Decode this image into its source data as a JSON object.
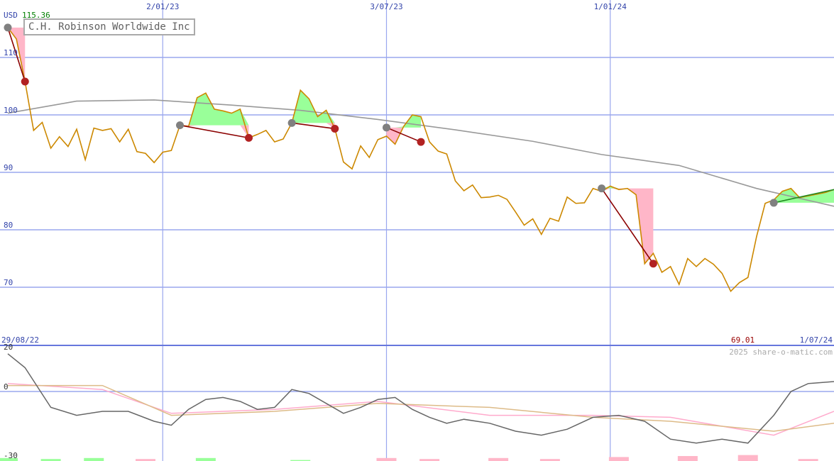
{
  "title": "C.H. Robinson Worldwide Inc",
  "currency": "USD",
  "top_value": "115.36",
  "low_value": "69.01",
  "start_date": "29/08/22",
  "end_date": "1/07/24",
  "watermark": "2025 share-o-matic.com",
  "colors": {
    "price": "#cc8800",
    "average": "#999999",
    "gain_fill": "#99ff99",
    "loss_fill": "#ffb6c8",
    "trade_loss_line": "#8b0000",
    "trade_gain_line": "#228b22",
    "entry_marker": "#808080",
    "exit_marker": "#b22222",
    "grid": "#9aa7ee",
    "axis_text": "#3344aa",
    "osc_price": "#666666",
    "osc_pink": "#ffaacc",
    "osc_tan": "#ddbb88"
  },
  "chart_data": [
    {
      "type": "line",
      "title": "C.H. Robinson Worldwide Inc",
      "ylabel": "USD",
      "ylim": [
        64.5,
        120
      ],
      "y_ticks": [
        70,
        80,
        90,
        100,
        110
      ],
      "x_range": [
        "29/08/22",
        "1/07/24"
      ],
      "x_ticks": [
        "2/01/23",
        "3/07/23",
        "1/01/24"
      ],
      "annotations": [
        "115.36",
        "69.01"
      ],
      "grid": true,
      "series": [
        {
          "role": "price",
          "x": [
            "2022-08-29",
            "2022-09-05",
            "2022-09-12",
            "2022-09-19",
            "2022-09-26",
            "2022-10-03",
            "2022-10-10",
            "2022-10-17",
            "2022-10-24",
            "2022-10-31",
            "2022-11-07",
            "2022-11-14",
            "2022-11-21",
            "2022-11-28",
            "2022-12-05",
            "2022-12-12",
            "2022-12-19",
            "2022-12-26",
            "2023-01-02",
            "2023-01-09",
            "2023-01-16",
            "2023-01-23",
            "2023-01-30",
            "2023-02-06",
            "2023-02-13",
            "2023-02-20",
            "2023-02-27",
            "2023-03-06",
            "2023-03-13",
            "2023-03-20",
            "2023-03-27",
            "2023-04-03",
            "2023-04-10",
            "2023-04-17",
            "2023-04-24",
            "2023-05-01",
            "2023-05-08",
            "2023-05-15",
            "2023-05-22",
            "2023-05-29",
            "2023-06-05",
            "2023-06-12",
            "2023-06-19",
            "2023-06-26",
            "2023-07-03",
            "2023-07-10",
            "2023-07-17",
            "2023-07-24",
            "2023-07-31",
            "2023-08-07",
            "2023-08-14",
            "2023-08-21",
            "2023-08-28",
            "2023-09-04",
            "2023-09-11",
            "2023-09-18",
            "2023-09-25",
            "2023-10-02",
            "2023-10-09",
            "2023-10-16",
            "2023-10-23",
            "2023-10-30",
            "2023-11-06",
            "2023-11-13",
            "2023-11-20",
            "2023-11-27",
            "2023-12-04",
            "2023-12-11",
            "2023-12-18",
            "2023-12-25",
            "2024-01-01",
            "2024-01-08",
            "2024-01-15",
            "2024-01-22",
            "2024-01-29",
            "2024-02-05",
            "2024-02-12",
            "2024-02-19",
            "2024-02-26",
            "2024-03-04",
            "2024-03-11",
            "2024-03-18",
            "2024-03-25",
            "2024-04-01",
            "2024-04-08",
            "2024-04-15",
            "2024-04-22",
            "2024-04-29",
            "2024-05-06",
            "2024-05-13",
            "2024-05-20",
            "2024-05-27",
            "2024-06-03",
            "2024-06-10",
            "2024-06-17",
            "2024-06-24",
            "2024-07-01"
          ],
          "values": [
            115.2,
            113.2,
            105.8,
            97.3,
            98.7,
            94.2,
            96.2,
            94.5,
            97.5,
            92.2,
            97.7,
            97.3,
            97.6,
            95.3,
            97.5,
            93.6,
            93.3,
            91.7,
            93.5,
            93.8,
            98.2,
            98.0,
            103.0,
            103.8,
            101.0,
            100.7,
            100.3,
            101.0,
            96.0,
            96.6,
            97.3,
            95.3,
            95.8,
            98.6,
            104.3,
            102.8,
            99.7,
            100.8,
            97.6,
            91.8,
            90.6,
            94.6,
            92.6,
            95.7,
            96.3,
            94.9,
            98.0,
            100.0,
            99.7,
            95.3,
            93.7,
            93.2,
            88.5,
            86.8,
            87.8,
            85.6,
            85.7,
            86.0,
            85.3,
            83.1,
            80.8,
            81.9,
            79.2,
            82.0,
            81.5,
            85.7,
            84.6,
            84.7,
            87.2,
            86.7,
            87.6,
            87.0,
            87.2,
            86.1,
            74.1,
            75.9,
            72.6,
            73.6,
            70.5,
            75.0,
            73.6,
            75.0,
            74.0,
            72.4,
            69.3,
            70.8,
            71.7,
            78.8,
            84.6,
            85.2,
            86.7,
            87.2,
            85.6,
            85.9,
            86.2,
            86.5,
            87.0
          ]
        },
        {
          "role": "moving-average",
          "x": [
            "2022-08-29",
            "2022-10-24",
            "2022-12-26",
            "2023-02-27",
            "2023-04-24",
            "2023-06-26",
            "2023-08-28",
            "2023-10-30",
            "2023-12-25",
            "2024-02-26",
            "2024-04-29",
            "2024-07-01"
          ],
          "values": [
            100.3,
            102.4,
            102.6,
            101.7,
            100.8,
            99.2,
            97.4,
            95.4,
            93.1,
            91.2,
            87.2,
            84.1
          ]
        }
      ],
      "trades": [
        {
          "entry_date": "2022-08-29",
          "entry": 115.2,
          "exit_date": "2022-09-12",
          "exit": 105.8,
          "result": "loss"
        },
        {
          "entry_date": "2023-01-16",
          "entry": 98.2,
          "exit_date": "2023-03-13",
          "exit": 96.0,
          "result": "loss"
        },
        {
          "entry_date": "2023-04-17",
          "entry": 98.6,
          "exit_date": "2023-05-22",
          "exit": 97.6,
          "result": "loss"
        },
        {
          "entry_date": "2023-07-03",
          "entry": 97.8,
          "exit_date": "2023-07-31",
          "exit": 95.3,
          "result": "loss"
        },
        {
          "entry_date": "2023-12-25",
          "entry": 87.2,
          "exit_date": "2024-02-05",
          "exit": 74.1,
          "result": "loss"
        },
        {
          "entry_date": "2024-05-13",
          "entry": 84.7,
          "exit_date": "2024-07-01",
          "exit": 87.0,
          "result": "gain"
        }
      ]
    },
    {
      "type": "line",
      "ylim": [
        -30,
        20
      ],
      "y_ticks": [
        20,
        0,
        -30
      ],
      "grid": true,
      "series": [
        {
          "role": "oscillator",
          "x": [
            "2022-08-29",
            "2022-09-12",
            "2022-10-03",
            "2022-10-24",
            "2022-11-14",
            "2022-12-05",
            "2022-12-26",
            "2023-01-09",
            "2023-01-23",
            "2023-02-06",
            "2023-02-20",
            "2023-03-06",
            "2023-03-20",
            "2023-04-03",
            "2023-04-17",
            "2023-05-01",
            "2023-05-15",
            "2023-05-29",
            "2023-06-12",
            "2023-06-26",
            "2023-07-10",
            "2023-07-24",
            "2023-08-07",
            "2023-08-21",
            "2023-09-04",
            "2023-09-25",
            "2023-10-16",
            "2023-11-06",
            "2023-11-27",
            "2023-12-18",
            "2024-01-08",
            "2024-01-29",
            "2024-02-19",
            "2024-03-11",
            "2024-04-01",
            "2024-04-22",
            "2024-05-13",
            "2024-05-27",
            "2024-06-10",
            "2024-07-01"
          ],
          "values": [
            19,
            12,
            -8,
            -12,
            -10,
            -10,
            -15,
            -17,
            -9,
            -4,
            -3,
            -5,
            -9,
            -8,
            1,
            -1,
            -6,
            -11,
            -8,
            -4,
            -3,
            -9,
            -13,
            -16,
            -14,
            -16,
            -20,
            -22,
            -19,
            -13,
            -12,
            -15,
            -24,
            -26,
            -24,
            -26,
            -12,
            0,
            4,
            5
          ]
        },
        {
          "role": "signal-pink",
          "x": [
            "2022-08-29",
            "2022-11-14",
            "2023-01-09",
            "2023-04-03",
            "2023-06-26",
            "2023-09-25",
            "2023-12-18",
            "2024-02-19",
            "2024-05-13",
            "2024-07-01"
          ],
          "values": [
            4,
            1,
            -11,
            -9,
            -5,
            -12,
            -12,
            -13,
            -22,
            -10
          ]
        },
        {
          "role": "signal-tan",
          "x": [
            "2022-08-29",
            "2022-11-14",
            "2023-01-09",
            "2023-04-03",
            "2023-06-26",
            "2023-09-25",
            "2023-12-18",
            "2024-02-19",
            "2024-05-13",
            "2024-07-01"
          ],
          "values": [
            3,
            3,
            -12,
            -10,
            -6,
            -8,
            -13,
            -15,
            -20,
            -16
          ]
        },
        {
          "role": "volume-bars",
          "x": [
            "2022-08-29",
            "2022-10-03",
            "2022-11-07",
            "2022-12-19",
            "2023-02-06",
            "2023-04-24",
            "2023-07-03",
            "2023-08-07",
            "2023-10-02",
            "2023-11-13",
            "2024-01-08",
            "2024-03-04",
            "2024-04-22",
            "2024-06-10"
          ],
          "values": [
            3,
            2,
            3,
            2,
            3,
            1,
            3,
            2,
            3,
            2,
            4,
            5,
            6,
            2
          ],
          "colors": [
            "gain",
            "gain",
            "gain",
            "loss",
            "gain",
            "gain",
            "loss",
            "loss",
            "loss",
            "loss",
            "loss",
            "loss",
            "loss",
            "loss"
          ]
        }
      ]
    }
  ]
}
